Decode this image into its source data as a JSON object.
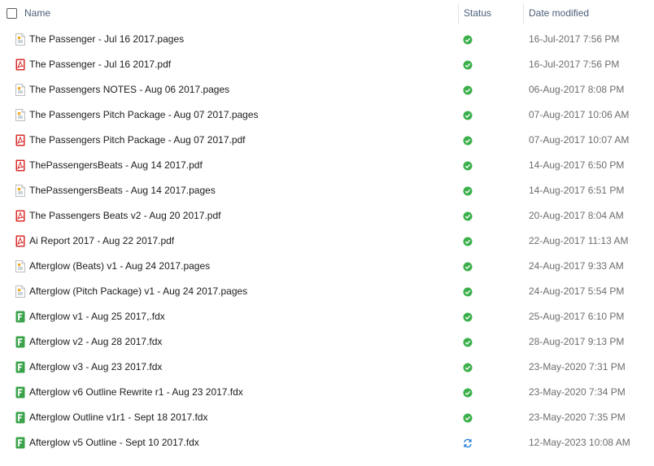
{
  "header": {
    "name_label": "Name",
    "status_label": "Status",
    "date_label": "Date modified"
  },
  "colors": {
    "header_text": "#4c607a",
    "pdf_red": "#d92b2b",
    "fdx_green": "#3aa34a",
    "status_green": "#3bb04a",
    "sync_blue": "#1e7ad6"
  },
  "files": [
    {
      "name": "The Passenger - Jul 16 2017.pages",
      "type": "pages",
      "status": "synced",
      "date": "16-Jul-2017 7:56 PM"
    },
    {
      "name": "The Passenger - Jul 16 2017.pdf",
      "type": "pdf",
      "status": "synced",
      "date": "16-Jul-2017 7:56 PM"
    },
    {
      "name": "The Passengers NOTES - Aug 06 2017.pages",
      "type": "pages",
      "status": "synced",
      "date": "06-Aug-2017 8:08 PM"
    },
    {
      "name": "The Passengers Pitch Package - Aug 07 2017.pages",
      "type": "pages",
      "status": "synced",
      "date": "07-Aug-2017 10:06 AM"
    },
    {
      "name": "The Passengers Pitch Package - Aug 07 2017.pdf",
      "type": "pdf",
      "status": "synced",
      "date": "07-Aug-2017 10:07 AM"
    },
    {
      "name": "ThePassengersBeats - Aug 14 2017.pdf",
      "type": "pdf",
      "status": "synced",
      "date": "14-Aug-2017 6:50 PM"
    },
    {
      "name": "ThePassengersBeats - Aug 14 2017.pages",
      "type": "pages",
      "status": "synced",
      "date": "14-Aug-2017 6:51 PM"
    },
    {
      "name": "The Passengers Beats v2 - Aug 20 2017.pdf",
      "type": "pdf",
      "status": "synced",
      "date": "20-Aug-2017 8:04 AM"
    },
    {
      "name": "Ai Report 2017 - Aug 22 2017.pdf",
      "type": "pdf",
      "status": "synced",
      "date": "22-Aug-2017 11:13 AM"
    },
    {
      "name": "Afterglow (Beats) v1 - Aug 24 2017.pages",
      "type": "pages",
      "status": "synced",
      "date": "24-Aug-2017 9:33 AM"
    },
    {
      "name": "Afterglow (Pitch Package) v1 - Aug 24 2017.pages",
      "type": "pages",
      "status": "synced",
      "date": "24-Aug-2017 5:54 PM"
    },
    {
      "name": "Afterglow v1 - Aug 25 2017,.fdx",
      "type": "fdx",
      "status": "synced",
      "date": "25-Aug-2017 6:10 PM"
    },
    {
      "name": "Afterglow v2 - Aug 28 2017.fdx",
      "type": "fdx",
      "status": "synced",
      "date": "28-Aug-2017 9:13 PM"
    },
    {
      "name": "Afterglow v3 - Aug 23 2017.fdx",
      "type": "fdx",
      "status": "synced",
      "date": "23-May-2020 7:31 PM"
    },
    {
      "name": "Afterglow v6 Outline Rewrite r1 - Aug 23 2017.fdx",
      "type": "fdx",
      "status": "synced",
      "date": "23-May-2020 7:34 PM"
    },
    {
      "name": "Afterglow Outline v1r1 - Sept 18 2017.fdx",
      "type": "fdx",
      "status": "synced",
      "date": "23-May-2020 7:35 PM"
    },
    {
      "name": "Afterglow v5 Outline - Sept 10 2017.fdx",
      "type": "fdx",
      "status": "syncing",
      "date": "12-May-2023 10:08 AM"
    }
  ]
}
